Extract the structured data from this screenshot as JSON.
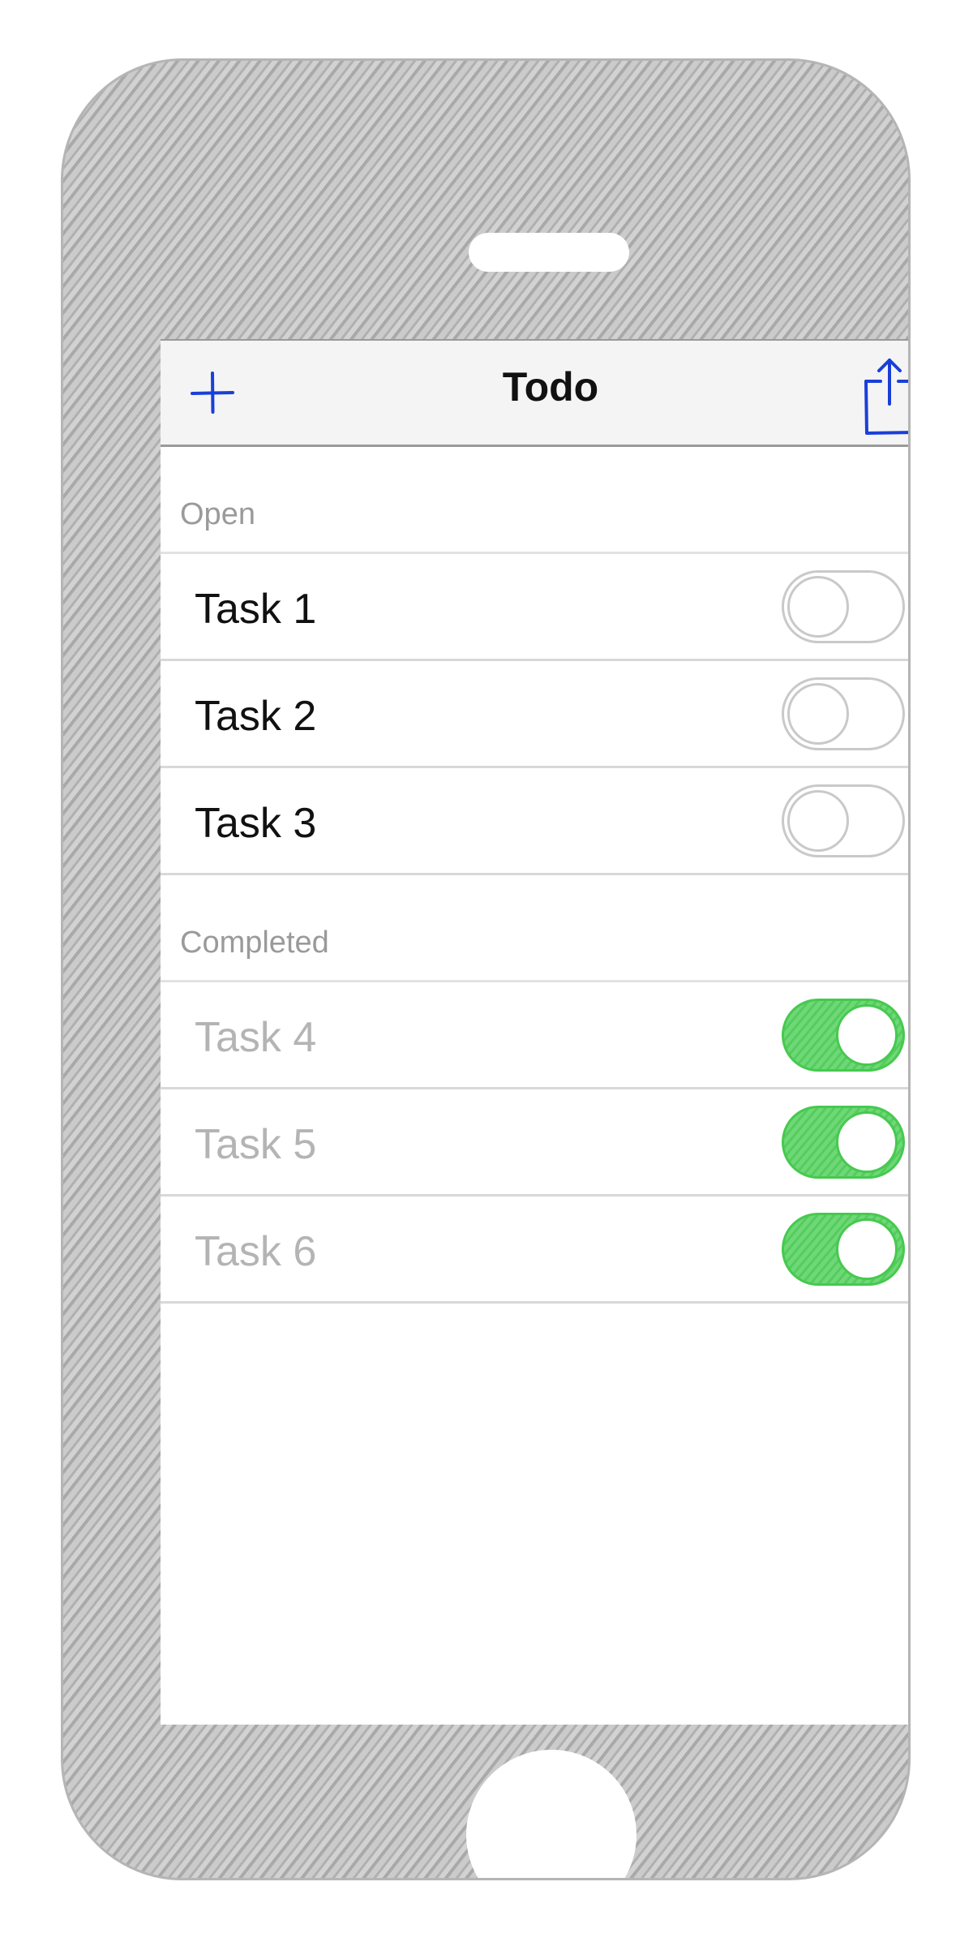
{
  "nav": {
    "title": "Todo",
    "add_icon": "plus-icon",
    "share_icon": "share-icon",
    "accent_color": "#1a3fd8"
  },
  "sections": {
    "open": {
      "header": "Open",
      "tasks": [
        {
          "label": "Task 1",
          "completed": false
        },
        {
          "label": "Task 2",
          "completed": false
        },
        {
          "label": "Task 3",
          "completed": false
        }
      ]
    },
    "completed": {
      "header": "Completed",
      "tasks": [
        {
          "label": "Task 4",
          "completed": true
        },
        {
          "label": "Task 5",
          "completed": true
        },
        {
          "label": "Task 6",
          "completed": true
        }
      ]
    }
  },
  "colors": {
    "toggle_on": "#4cd964",
    "toggle_off": "#c9c9c9",
    "completed_text": "#b4b4b4",
    "section_header_text": "#9a9a9a"
  }
}
